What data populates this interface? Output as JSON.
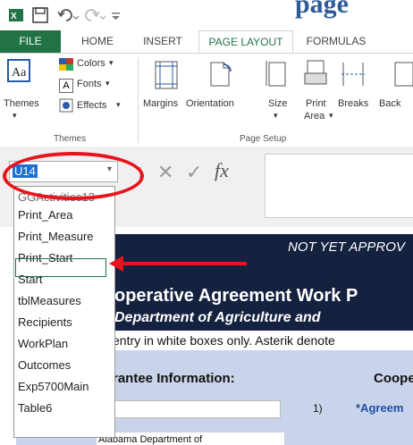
{
  "title_bar": {
    "partial_title": "page"
  },
  "tabs": [
    {
      "label": "FILE"
    },
    {
      "label": "HOME"
    },
    {
      "label": "INSERT"
    },
    {
      "label": "PAGE LAYOUT"
    },
    {
      "label": "FORMULAS"
    }
  ],
  "ribbon": {
    "themes_group": {
      "themes": "Themes",
      "colors": "Colors",
      "fonts": "Fonts",
      "effects": "Effects",
      "group_label": "Themes"
    },
    "page_setup": {
      "margins": "Margins",
      "orientation": "Orientation",
      "size": "Size",
      "print_area_line1": "Print",
      "print_area_line2": "Area",
      "breaks": "Breaks",
      "background": "Back",
      "group_label": "Page Setup"
    }
  },
  "namebox": {
    "value": "U14"
  },
  "formula_bar": {
    "fx": "fx",
    "cancel": "✕",
    "enter": "✓"
  },
  "dropdown": {
    "items": [
      "GGActivities13",
      "Print_Area",
      "Print_Measure",
      "Print_Start",
      "Start",
      "tblMeasures",
      "Recipients",
      "WorkPlan",
      "Outcomes",
      "Exp5700Main",
      "Table6"
    ],
    "selected": "Print_Start"
  },
  "sheet": {
    "not_approved": "NOT YET APPROV",
    "title_line1": "operative Agreement Work P",
    "title_line2": "Department of Agriculture and",
    "instructions": "entry in white boxes only. Asterik denote",
    "grantee_info": "rantee Information:",
    "coop": "Coope",
    "row_number": "1)",
    "agreement": "*Agreem",
    "alabama": "Alabama Department of"
  },
  "colors": {
    "excel_green": "#217346",
    "banner_navy": "#14213f",
    "highlight_red": "#e8141b",
    "agreement_blue": "#1f4fa8",
    "namebox_highlight": "#1e6fd0"
  }
}
